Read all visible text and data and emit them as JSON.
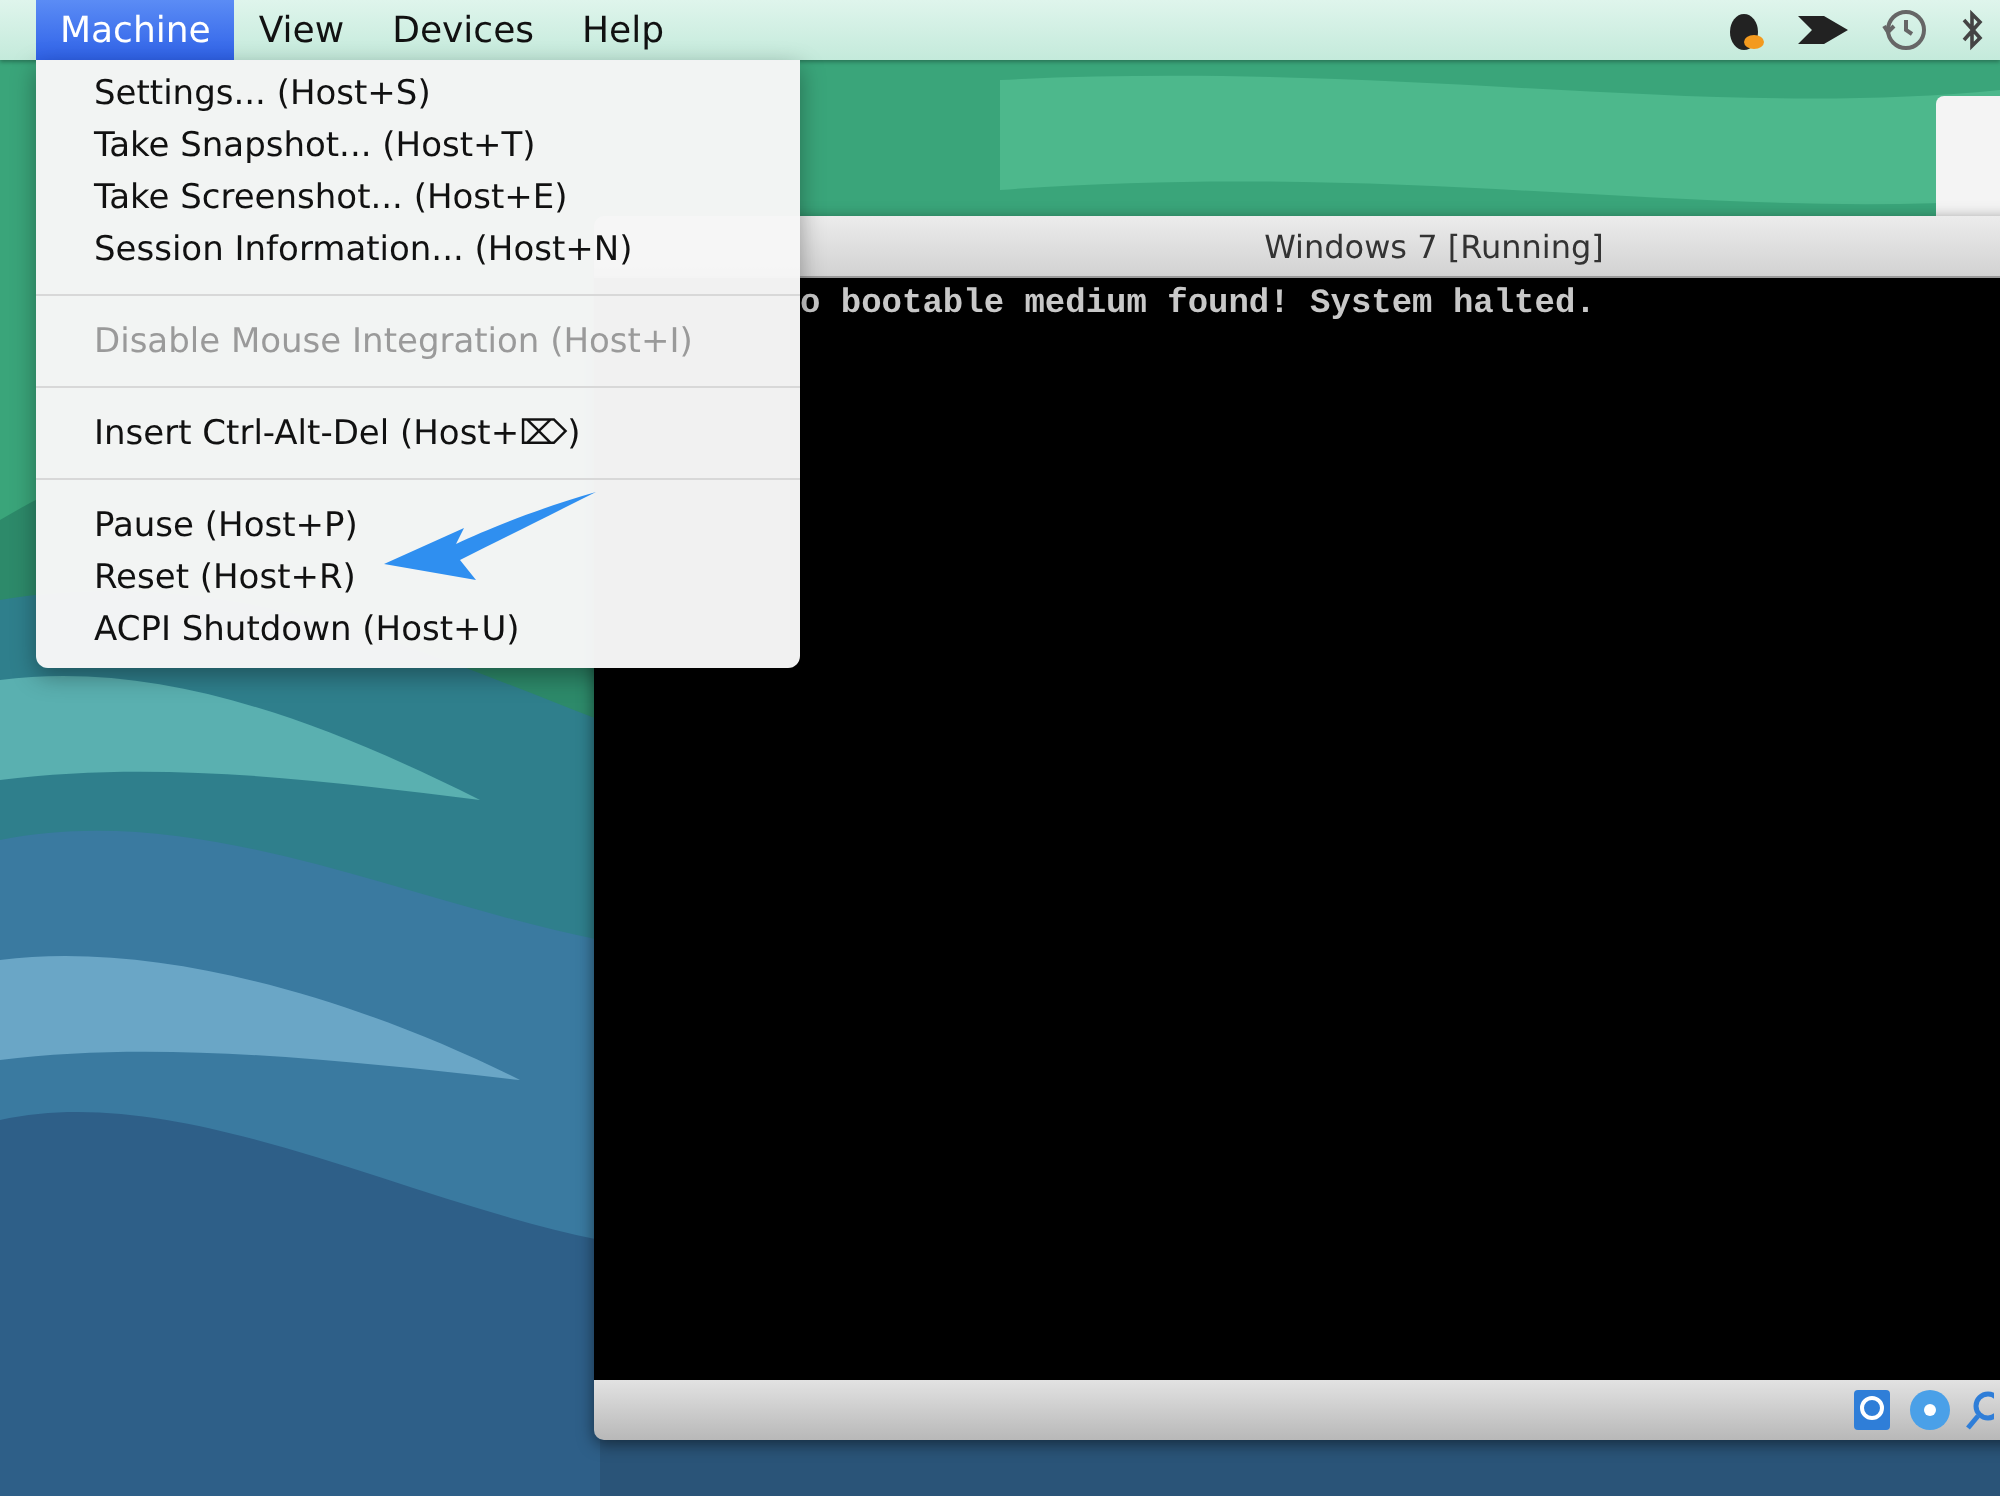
{
  "menu_bar": {
    "menus": [
      {
        "label": "Machine",
        "selected": true
      },
      {
        "label": "View",
        "selected": false
      },
      {
        "label": "Devices",
        "selected": false
      },
      {
        "label": "Help",
        "selected": false
      }
    ]
  },
  "dropdown": {
    "groups": [
      [
        {
          "label": "Settings... (Host+S)",
          "disabled": false
        },
        {
          "label": "Take Snapshot... (Host+T)",
          "disabled": false
        },
        {
          "label": "Take Screenshot... (Host+E)",
          "disabled": false
        },
        {
          "label": "Session Information... (Host+N)",
          "disabled": false
        }
      ],
      [
        {
          "label": "Disable Mouse Integration (Host+I)",
          "disabled": true
        }
      ],
      [
        {
          "label": "Insert Ctrl-Alt-Del (Host+⌦)",
          "disabled": false
        }
      ],
      [
        {
          "label": "Pause (Host+P)",
          "disabled": false
        },
        {
          "label": "Reset (Host+R)",
          "disabled": false
        },
        {
          "label": "ACPI Shutdown (Host+U)",
          "disabled": false
        }
      ]
    ]
  },
  "vm_window": {
    "title": "Windows 7 [Running]",
    "console_text": "o bootable medium found! System halted."
  }
}
